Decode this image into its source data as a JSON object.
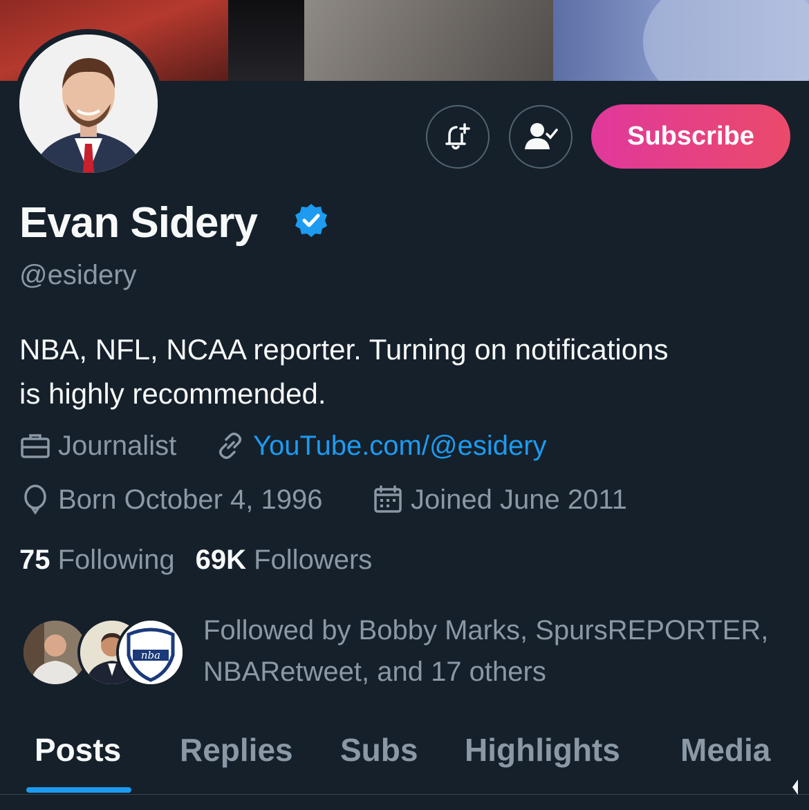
{
  "profile": {
    "name": "Evan Sidery",
    "handle": "@esidery",
    "bio_line1": "NBA, NFL, NCAA reporter. Turning on notifications",
    "bio_line2": "is highly recommended.",
    "profession": "Journalist",
    "website": "YouTube.com/@esidery",
    "born": "Born October 4, 1996",
    "joined": "Joined June 2011"
  },
  "actions": {
    "subscribe_label": "Subscribe",
    "notify_icon": "bell-plus-icon",
    "following_icon": "person-check-icon"
  },
  "stats": {
    "following_count": "75",
    "following_label": "Following",
    "followers_count": "69K",
    "followers_label": "Followers"
  },
  "followed_by": {
    "line1": "Followed by Bobby Marks, SpursREPORTER,",
    "line2": "NBARetweet, and 17 others",
    "third_avatar_text": "nba"
  },
  "tabs": [
    {
      "label": "Posts",
      "active": true
    },
    {
      "label": "Replies",
      "active": false
    },
    {
      "label": "Subs",
      "active": false
    },
    {
      "label": "Highlights",
      "active": false
    },
    {
      "label": "Media",
      "active": false
    }
  ],
  "colors": {
    "background": "#15202b",
    "accent": "#1d9bf0",
    "subscribe_gradient_start": "#e0389c",
    "subscribe_gradient_end": "#ea4a6a",
    "muted_text": "#8b98a5"
  }
}
